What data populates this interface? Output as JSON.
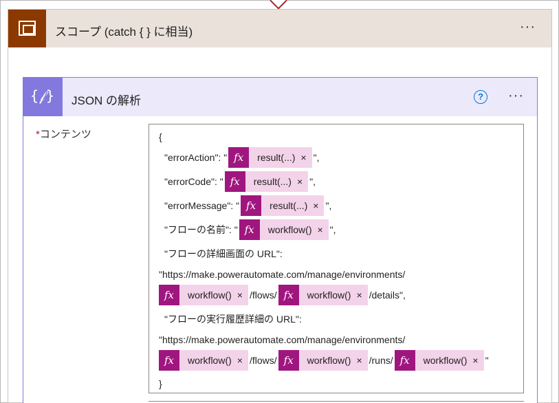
{
  "scope": {
    "title": "スコープ (catch { } に相当)",
    "menu_glyph": "···",
    "icon": "scope-icon",
    "accent_color": "#8c3900"
  },
  "json_action": {
    "title": "JSON の解析",
    "icon_glyph": "{𝒻}",
    "icon": "json-braces-icon",
    "help_glyph": "?",
    "menu_glyph": "···",
    "accent_color": "#8378de"
  },
  "content_field": {
    "required_mark": "*",
    "label": "コンテンツ"
  },
  "token_style": {
    "fx_glyph": "fx",
    "close_glyph": "×",
    "color": "#a0167f"
  },
  "editor_lines": {
    "l1": "{",
    "l2_pre": "\"errorAction\": \"",
    "l2_tok": "result(...)",
    "l2_post": "\",",
    "l3_pre": "\"errorCode\": \"",
    "l3_tok": "result(...)",
    "l3_post": "\",",
    "l4_pre": "\"errorMessage\": \"",
    "l4_tok": "result(...)",
    "l4_post": "\",",
    "l5_pre": "\"フローの名前\": \"",
    "l5_tok": "workflow()",
    "l5_post": "\",",
    "l6": "\"フローの詳細画面の URL\":",
    "l7": "\"https://make.powerautomate.com/manage/environments/",
    "l8_tok1": "workflow()",
    "l8_mid": "/flows/",
    "l8_tok2": "workflow()",
    "l8_post": "/details\",",
    "l9": "\"フローの実行履歴詳細の URL\":",
    "l10": "\"https://make.powerautomate.com/manage/environments/",
    "l11_tok1": "workflow()",
    "l11_mid1": "/flows/",
    "l11_tok2": "workflow()",
    "l11_mid2": "/runs/",
    "l11_tok3": "workflow()",
    "l11_post": "\"",
    "l12": "}"
  }
}
